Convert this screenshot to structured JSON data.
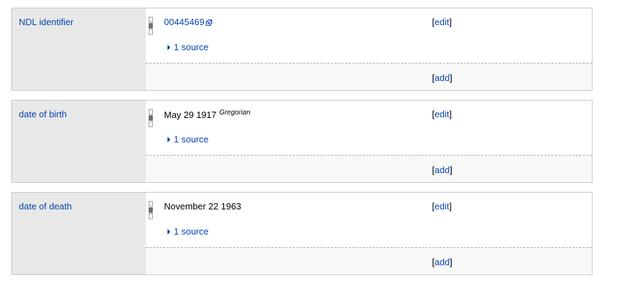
{
  "groups": [
    {
      "property": "NDL identifier",
      "value": "00445469",
      "value_is_link": true,
      "calendar": "",
      "sources": "1 source",
      "edit": "edit",
      "add": "add"
    },
    {
      "property": "date of birth",
      "value": "May 29 1917",
      "value_is_link": false,
      "calendar": "Gregorian",
      "sources": "1 source",
      "edit": "edit",
      "add": "add"
    },
    {
      "property": "date of death",
      "value": "November 22 1963",
      "value_is_link": false,
      "calendar": "",
      "sources": "1 source",
      "edit": "edit",
      "add": "add"
    }
  ],
  "brackets": {
    "open": "[",
    "close": "]"
  },
  "icons": {
    "external_link": "external-link-icon",
    "rank": "rank-selector-icon",
    "sources_toggle": "triangle-right-icon"
  },
  "colors": {
    "link": "#0645ad",
    "property_bg": "#e8e8e8",
    "toolbar_bg": "#f8f8f8",
    "border": "#c8c8c8"
  }
}
